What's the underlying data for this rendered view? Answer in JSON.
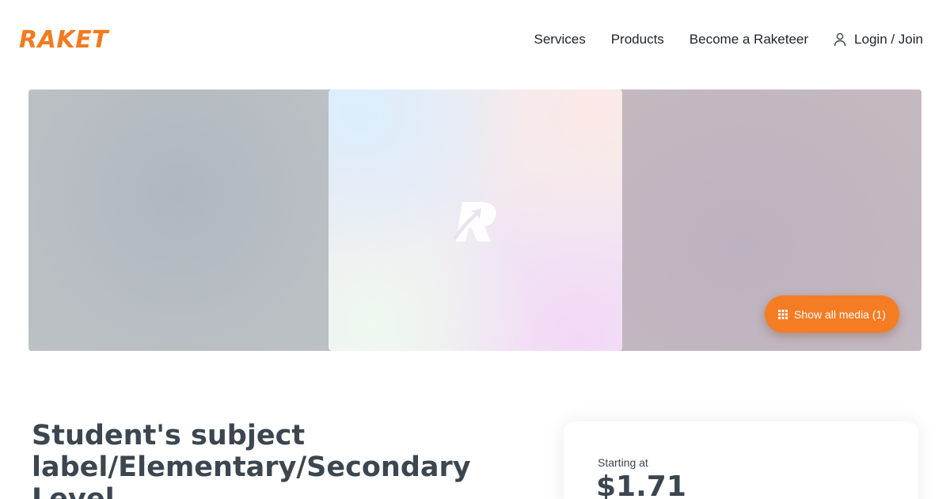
{
  "brand": {
    "logo_text": "RAKET",
    "accent_color": "#f37a1f"
  },
  "nav": {
    "items": [
      {
        "label": "Services"
      },
      {
        "label": "Products"
      },
      {
        "label": "Become a Raketeer"
      }
    ],
    "login_label": "Login / Join",
    "login_icon": "user-icon"
  },
  "gallery": {
    "center_image_icon": "raket-r-logo-icon",
    "media_button_label": "Show all media (1)",
    "media_button_icon": "grid-icon",
    "media_button_color": "#f57c23"
  },
  "listing": {
    "title": "Student's subject label/Elementary/Secondary Level"
  },
  "pricing": {
    "starting_label": "Starting at",
    "price": "$1.71"
  }
}
